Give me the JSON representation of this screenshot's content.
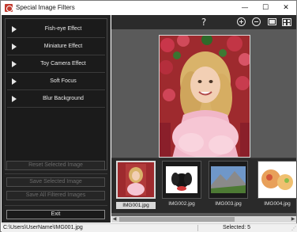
{
  "window": {
    "title": "Special Image Filters",
    "minimize_glyph": "—",
    "maximize_glyph": "☐",
    "close_glyph": "✕"
  },
  "effects": [
    {
      "label": "Fish-eye Effect"
    },
    {
      "label": "Miniature Effect"
    },
    {
      "label": "Toy Camera Effect"
    },
    {
      "label": "Soft Focus"
    },
    {
      "label": "Blur Background"
    }
  ],
  "buttons": {
    "reset": "Reset Selected Image",
    "save_selected": "Save Selected Image",
    "save_all": "Save All Filtered Images",
    "exit": "Exit"
  },
  "toolbar": {
    "help_glyph": "?",
    "icons": [
      "help-icon",
      "zoom-in-icon",
      "zoom-out-icon",
      "full-screen-icon",
      "thumbnail-view-icon"
    ]
  },
  "thumbnails": [
    {
      "filename": "IMG001.jpg",
      "selected": true
    },
    {
      "filename": "IMG002.jpg",
      "selected": false
    },
    {
      "filename": "IMG003.jpg",
      "selected": false
    },
    {
      "filename": "IMG004.jpg",
      "selected": false
    }
  ],
  "scrollbar": {
    "left_glyph": "◀",
    "right_glyph": "▶"
  },
  "status": {
    "path": "C:\\Users\\UserName\\IMG001.jpg",
    "selected": "Selected: 5"
  },
  "colors": {
    "panel_background": "#222222",
    "preview_background": "#5a5a5a",
    "selected_frame": "#d9d9d9"
  }
}
